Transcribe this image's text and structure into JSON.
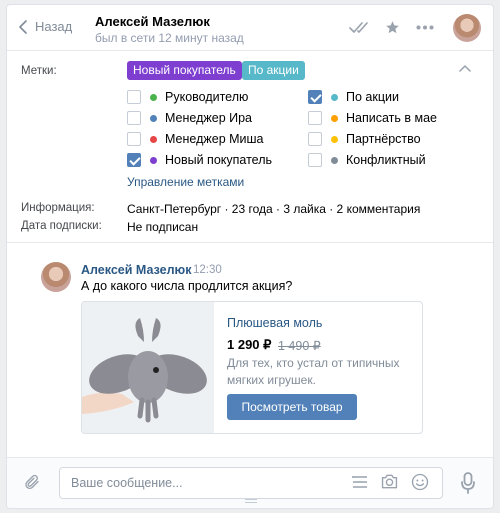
{
  "header": {
    "back_label": "Назад",
    "name": "Алексей Мазелюк",
    "status": "был в сети 12 минут назад"
  },
  "labels": {
    "tags_label": "Метки:",
    "active_tags": [
      {
        "text": "Новый покупатель",
        "color": "#7e3fd1"
      },
      {
        "text": "По акции",
        "color": "#56b8c8"
      }
    ],
    "options_left": [
      {
        "text": "Руководителю",
        "color": "#4bb34b",
        "checked": false
      },
      {
        "text": "Менеджер Ира",
        "color": "#5181b8",
        "checked": false
      },
      {
        "text": "Менеджер Миша",
        "color": "#e64646",
        "checked": false
      },
      {
        "text": "Новый покупатель",
        "color": "#7e3fd1",
        "checked": true
      }
    ],
    "options_right": [
      {
        "text": "По акции",
        "color": "#56b8c8",
        "checked": true
      },
      {
        "text": "Написать в мае",
        "color": "#ffa000",
        "checked": false
      },
      {
        "text": "Партнёрство",
        "color": "#ffc107",
        "checked": false
      },
      {
        "text": "Конфликтный",
        "color": "#818c99",
        "checked": false
      }
    ],
    "manage_link": "Управление метками"
  },
  "info": {
    "info_label": "Информация:",
    "info_value": "Санкт-Петербург · 23 года · 3 лайка · 2 комментария",
    "sub_label": "Дата подписки:",
    "sub_value": "Не подписан"
  },
  "message": {
    "author": "Алексей Мазелюк",
    "time": "12:30",
    "text": "А до какого числа продлится акция?",
    "product": {
      "title": "Плюшевая моль",
      "price": "1 290 ₽",
      "old_price": "1 490 ₽",
      "description": "Для тех, кто устал от типичных мягких игрушек.",
      "button": "Посмотреть товар"
    }
  },
  "composer": {
    "placeholder": "Ваше сообщение..."
  }
}
